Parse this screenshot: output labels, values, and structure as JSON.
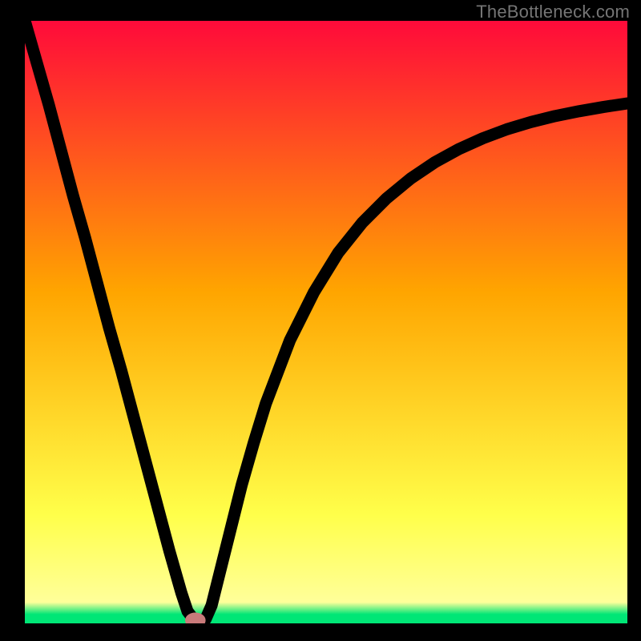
{
  "watermark": "TheBottleneck.com",
  "chart_data": {
    "type": "line",
    "title": "",
    "xlabel": "",
    "ylabel": "",
    "xlim": [
      0,
      100
    ],
    "ylim": [
      0,
      100
    ],
    "grid": false,
    "legend": false,
    "background_gradient": {
      "top": "#ff0a3a",
      "mid1": "#ffa500",
      "mid2": "#ffff4a",
      "green": "#00e676",
      "bottom": "#00e676"
    },
    "series": [
      {
        "name": "bottleneck-curve",
        "x": [
          0,
          2,
          4,
          6,
          8,
          10,
          12,
          14,
          16,
          18,
          20,
          22,
          24,
          26,
          27,
          28,
          29,
          30,
          31,
          32,
          34,
          36,
          38,
          40,
          44,
          48,
          52,
          56,
          60,
          64,
          68,
          72,
          76,
          80,
          84,
          88,
          92,
          96,
          100
        ],
        "y": [
          100,
          93,
          86,
          78.5,
          71,
          64,
          56.5,
          49,
          42,
          34.5,
          27,
          19.5,
          12,
          5,
          2,
          0.7,
          0.1,
          0.7,
          3,
          7,
          15,
          23,
          30,
          36.5,
          47,
          55,
          61.5,
          66.5,
          70.5,
          73.8,
          76.5,
          78.7,
          80.5,
          82,
          83.2,
          84.2,
          85,
          85.7,
          86.3
        ]
      }
    ],
    "marker": {
      "name": "optimum-point",
      "x": 28.3,
      "y": 0.5,
      "rx": 1.2,
      "ry": 0.8,
      "color": "#c97a7a"
    }
  }
}
